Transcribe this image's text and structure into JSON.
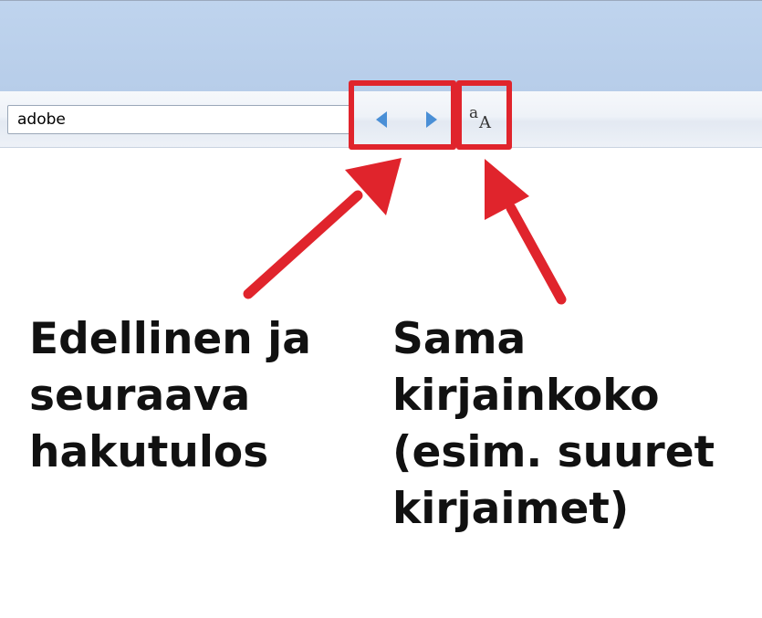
{
  "search": {
    "value": "adobe"
  },
  "toolbar": {
    "prev_icon": "triangle-left-icon",
    "next_icon": "triangle-right-icon",
    "match_case_icon": "match-case-icon",
    "match_case_glyph_small": "a",
    "match_case_glyph_large": "A",
    "accent_color": "#4a8fd6"
  },
  "annotation": {
    "highlight_color": "#e0242c",
    "nav_caption": [
      "Edellinen ja",
      "seuraava",
      "hakutulos"
    ],
    "case_caption": [
      "Sama",
      "kirjainkoko",
      "(esim. suuret",
      "kirjaimet)"
    ]
  }
}
